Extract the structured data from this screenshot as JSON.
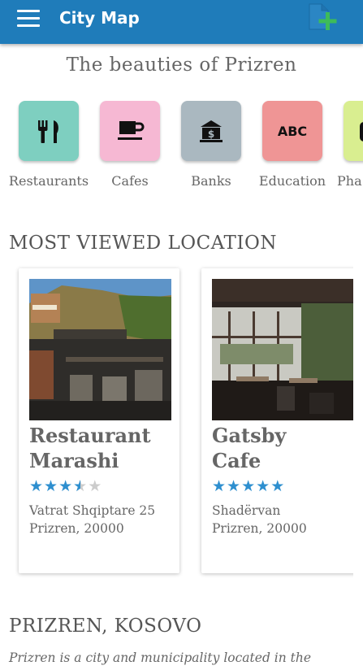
{
  "appbar": {
    "title": "City Map"
  },
  "page": {
    "subtitle": "The beauties of Prizren"
  },
  "categories": [
    {
      "label": "Restaurants",
      "icon": "fork-knife-icon",
      "color": "#7ecfc0"
    },
    {
      "label": "Cafes",
      "icon": "coffee-cup-icon",
      "color": "#f6b8d3"
    },
    {
      "label": "Banks",
      "icon": "bank-icon",
      "color": "#aab8c0"
    },
    {
      "label": "Education",
      "icon": "abc-icon",
      "icon_text": "ABC",
      "color": "#ef9595"
    },
    {
      "label": "Pha",
      "icon": "pharmacy-icon",
      "color": "#d9ee90"
    }
  ],
  "most_viewed": {
    "heading": "MOST VIEWED LOCATION",
    "cards": [
      {
        "title": "Restaurant Marashi",
        "rating": 3.5,
        "rating_max": 5,
        "address_line1": "Vatrat Shqiptare 25",
        "address_line2": "Prizren, 20000"
      },
      {
        "title": "Gatsby Cafe",
        "rating": 5,
        "rating_max": 5,
        "address_line1": "Shadërvan",
        "address_line2": "Prizren, 20000"
      }
    ]
  },
  "about": {
    "heading": "PRIZREN, KOSOVO",
    "text": "Prizren is a city and municipality located in the"
  },
  "colors": {
    "appbar": "#1f7cba",
    "star": "#2e8fcf",
    "add_icon_green": "#3dbb5a"
  }
}
